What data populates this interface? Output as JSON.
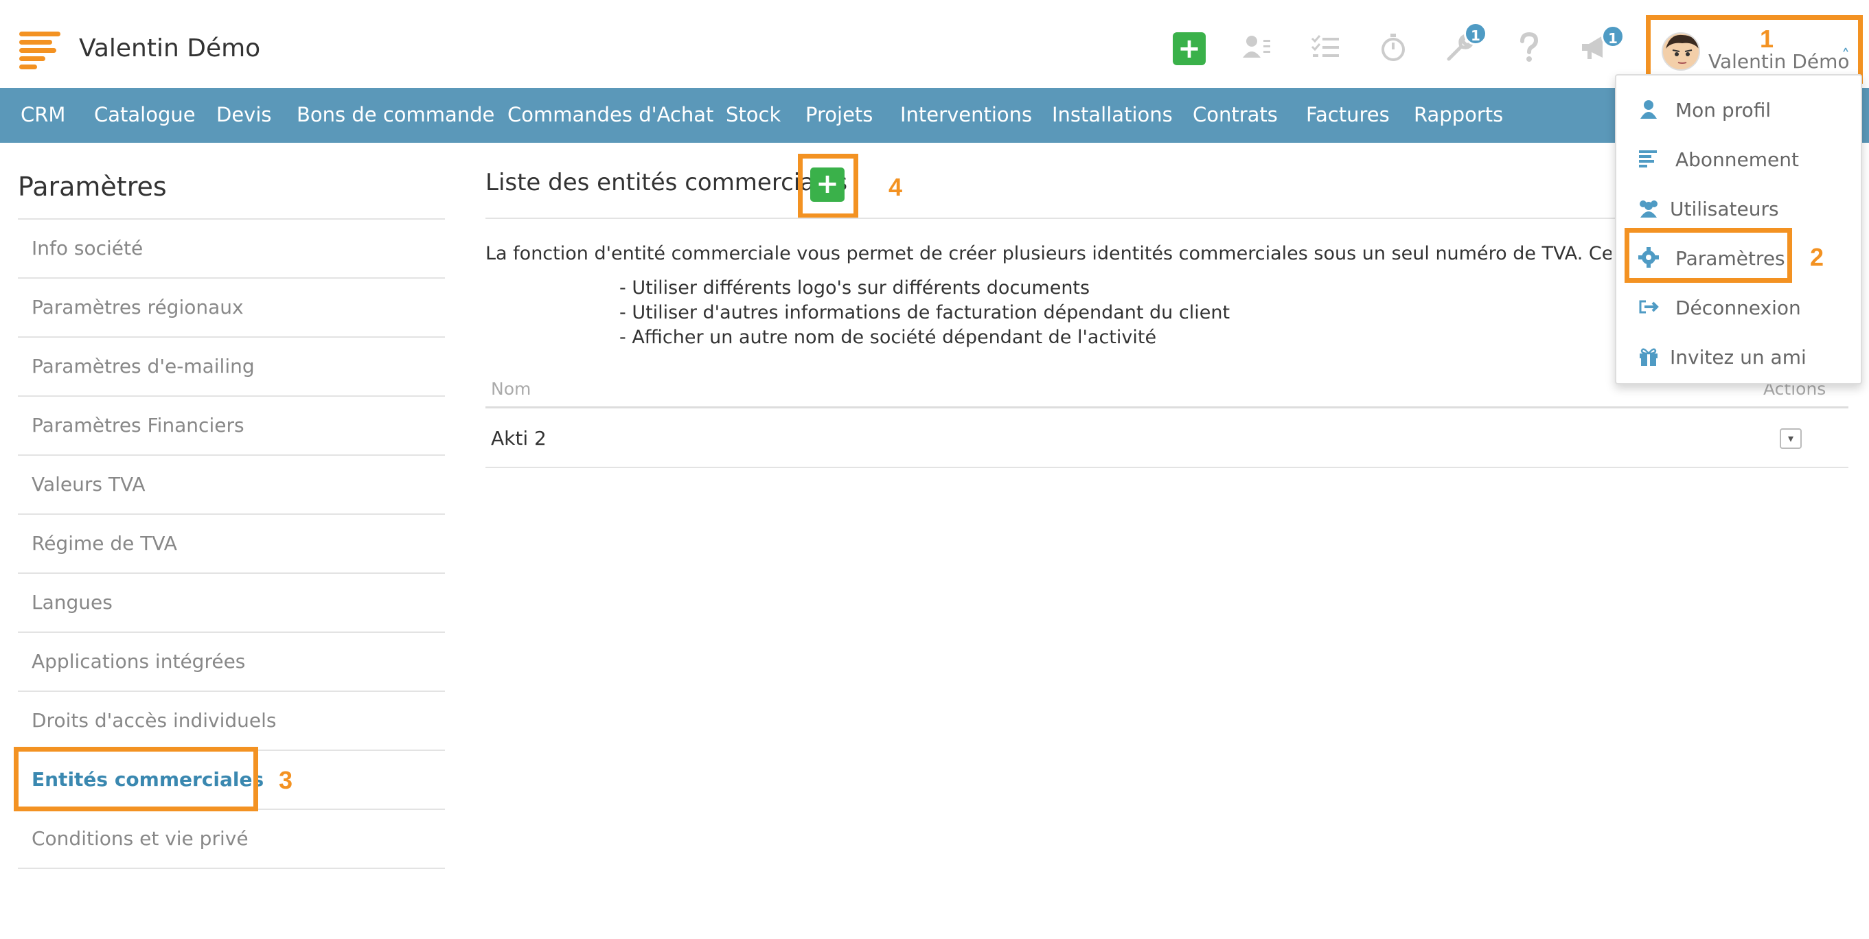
{
  "header": {
    "app_title": "Valentin Démo",
    "add_label": "+",
    "icons": [
      "add-icon",
      "contacts-icon",
      "tasks-icon",
      "timer-icon",
      "wrench-icon",
      "help-icon",
      "megaphone-icon"
    ],
    "wrench_badge": "1",
    "megaphone_badge": "1",
    "user_name": "Valentin Démo",
    "user_chevron": "˄",
    "accent_color": "#f39222",
    "add_color": "#3ab14a"
  },
  "annotations": {
    "one": "1",
    "two": "2",
    "three": "3",
    "four": "4"
  },
  "nav": {
    "bar_color": "#5b98b9",
    "items": [
      "CRM",
      "Catalogue",
      "Devis",
      "Bons de commande",
      "Commandes d'Achat",
      "Stock",
      "Projets",
      "Interventions",
      "Installations",
      "Contrats",
      "Factures",
      "Rapports"
    ]
  },
  "sidebar": {
    "title": "Paramètres",
    "items": [
      "Info société",
      "Paramètres régionaux",
      "Paramètres d'e-mailing",
      "Paramètres Financiers",
      "Valeurs TVA",
      "Régime de TVA",
      "Langues",
      "Applications intégrées",
      "Droits d'accès individuels",
      "Entités commerciales",
      "Conditions et vie privé"
    ],
    "active_item": "Entités commerciales"
  },
  "main": {
    "title": "Liste des entités commerciales",
    "add_label": "+",
    "intro": "La fonction d'entité commerciale vous permet de créer plusieurs identités commerciales sous un seul numéro de TVA. Ceci vous permet",
    "bullets": [
      "- Utiliser différents logo's sur différents documents",
      "- Utiliser d'autres informations de facturation dépendant du client",
      "- Afficher un autre nom de société dépendant de l'activité"
    ],
    "table": {
      "col_name": "Nom",
      "col_actions": "Actions",
      "rows": [
        {
          "name": "Akti 2",
          "action": "▾"
        }
      ]
    }
  },
  "dropdown": {
    "items": [
      {
        "label": "Mon profil",
        "icon": "user-icon"
      },
      {
        "label": "Abonnement",
        "icon": "list-icon"
      },
      {
        "label": "Utilisateurs",
        "icon": "users-icon"
      },
      {
        "label": "Paramètres",
        "icon": "gear-icon"
      },
      {
        "label": "Déconnexion",
        "icon": "logout-icon"
      },
      {
        "label": "Invitez un ami",
        "icon": "gift-icon"
      }
    ]
  }
}
